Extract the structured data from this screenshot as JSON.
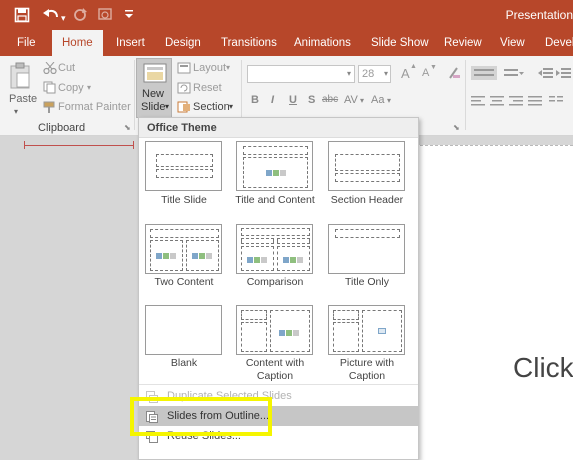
{
  "window": {
    "title": "Presentation"
  },
  "quick_access": {
    "icons": [
      "save-icon",
      "undo-icon",
      "redo-icon",
      "start-from-beginning-icon",
      "customize-qat-icon"
    ],
    "save_glyph": "🖫",
    "undo_glyph": "↶",
    "redo_glyph": "↻",
    "present_glyph": "▣",
    "more_glyph": "⌄"
  },
  "tabs": [
    {
      "label": "File"
    },
    {
      "label": "Home"
    },
    {
      "label": "Insert"
    },
    {
      "label": "Design"
    },
    {
      "label": "Transitions"
    },
    {
      "label": "Animations"
    },
    {
      "label": "Slide Show"
    },
    {
      "label": "Review"
    },
    {
      "label": "View"
    },
    {
      "label": "Develo"
    }
  ],
  "ribbon": {
    "clipboard": {
      "paste_label": "Paste",
      "cut_label": "Cut",
      "copy_label": "Copy",
      "format_painter_label": "Format Painter",
      "group_label": "Clipboard"
    },
    "slides": {
      "new_slide_label_line1": "New",
      "new_slide_label_line2": "Slide",
      "layout_label": "Layout",
      "reset_label": "Reset",
      "section_label": "Section"
    },
    "font": {
      "font_name": "",
      "font_size": "28",
      "bold": "B",
      "italic": "I",
      "underline": "U",
      "shadow": "S",
      "strike": "abc",
      "spacing": "AV",
      "case": "Aa",
      "grow": "A",
      "shrink": "A"
    }
  },
  "gallery": {
    "header": "Office Theme",
    "layouts": [
      {
        "label": "Title Slide"
      },
      {
        "label": "Title and Content"
      },
      {
        "label": "Section Header"
      },
      {
        "label": "Two Content"
      },
      {
        "label": "Comparison"
      },
      {
        "label": "Title Only"
      },
      {
        "label": "Blank"
      },
      {
        "label": "Content with Caption"
      },
      {
        "label": "Picture with Caption"
      }
    ],
    "menu": [
      {
        "label": "Duplicate Selected Slides",
        "state": "disabled"
      },
      {
        "label": "Slides from Outline...",
        "state": "hover"
      },
      {
        "label": "Reuse Slides...",
        "state": "normal"
      }
    ]
  },
  "slide": {
    "placeholder_text": "Click"
  },
  "colors": {
    "accent": "#b7472a",
    "highlight": "#f5f500"
  }
}
